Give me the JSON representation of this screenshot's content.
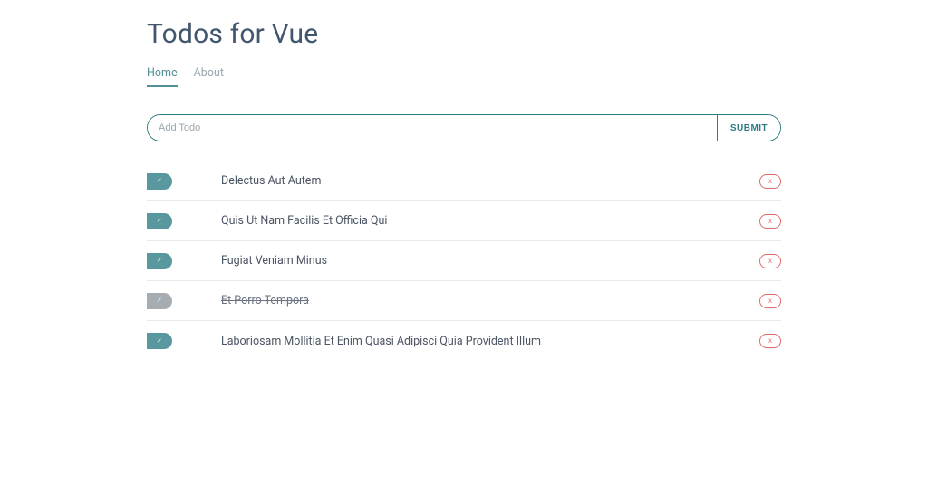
{
  "header": {
    "title": "Todos for Vue"
  },
  "nav": {
    "home": "Home",
    "about": "About",
    "active": "home"
  },
  "form": {
    "placeholder": "Add Todo",
    "submit_label": "Submit"
  },
  "icons": {
    "check": "✓",
    "delete": "x"
  },
  "colors": {
    "accent": "#2e7d83",
    "check_active": "#5a98a0",
    "check_done": "#a7acb1",
    "danger": "#e06b6b"
  },
  "todos": [
    {
      "title": "Delectus Aut Autem",
      "completed": false
    },
    {
      "title": "Quis Ut Nam Facilis Et Officia Qui",
      "completed": false
    },
    {
      "title": "Fugiat Veniam Minus",
      "completed": false
    },
    {
      "title": "Et Porro Tempora",
      "completed": true
    },
    {
      "title": "Laboriosam Mollitia Et Enim Quasi Adipisci Quia Provident Illum",
      "completed": false
    }
  ]
}
